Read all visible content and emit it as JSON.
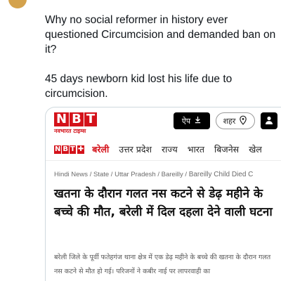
{
  "tweet": {
    "paragraph_1": "Why no social reformer in history ever questioned Circumcision and demanded ban on it?",
    "paragraph_2": "45 days newborn kid lost his life due to circumcision."
  },
  "card": {
    "logo": {
      "letters": [
        "N",
        "B",
        "T"
      ],
      "subtitle": "नवभारत टाइम्स"
    },
    "app_button": "ऐप",
    "city_button": "शहर",
    "nav": {
      "logo_letters": [
        "N",
        "B",
        "T"
      ],
      "items": [
        "बरेली",
        "उत्तर प्रदेश",
        "राज्य",
        "भारत",
        "बिजनेस",
        "खेल"
      ],
      "active_index": 0
    },
    "breadcrumb": [
      "Hindi News",
      "State",
      "Uttar Pradesh",
      "Bareilly",
      "Bareilly Child Died C"
    ],
    "headline": "खतना के दौरान गलत नस कटने से डेढ़ महीने के बच्चे की मौत, बरेली में दिल दहला देने वाली घटना",
    "summary": "बरेली जिले के पूर्वी फतेहगंज थाना क्षेत्र में एक डेढ़ महीने के बच्चे की खतना के दौरान गलत नस कटने से मौत हो गई। परिजनों ने कबीर नाई पर लापरवाही का"
  },
  "colors": {
    "brand_red": "#d4121a",
    "border": "#cfd9de",
    "text": "#0f1419"
  }
}
